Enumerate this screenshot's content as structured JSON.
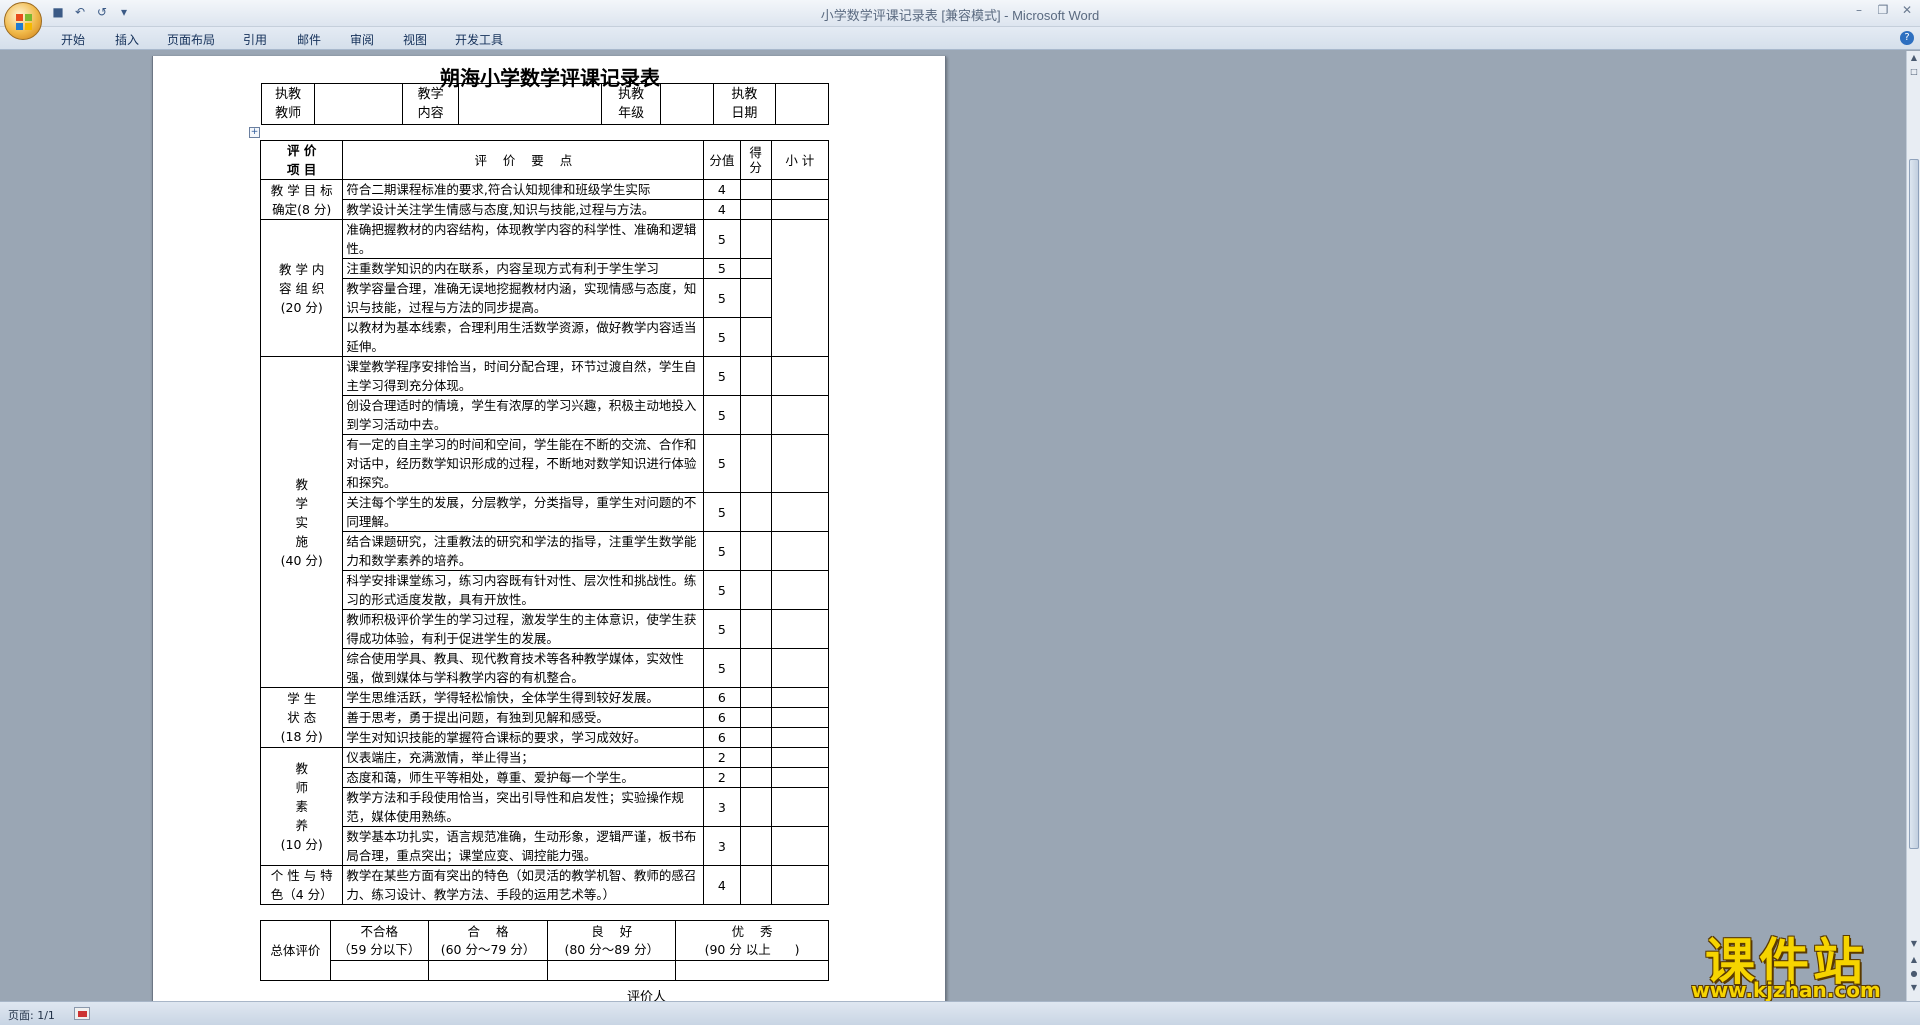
{
  "window": {
    "title": "小学数学评课记录表 [兼容模式] - Microsoft Word"
  },
  "qat": [
    "save-icon",
    "undo-icon",
    "redo-icon",
    "customize-icon"
  ],
  "tabs": [
    "开始",
    "插入",
    "页面布局",
    "引用",
    "邮件",
    "审阅",
    "视图",
    "开发工具"
  ],
  "document": {
    "title": "朔海小学数学评课记录表",
    "info": {
      "teacher_label": "执教\n教师",
      "content_label": "教学\n内容",
      "grade_label": "执教\n年级",
      "date_label": "执教\n日期"
    },
    "headers": {
      "item": "评 价\n项 目",
      "points": "评    价    要    点",
      "score": "分值",
      "got": "得\n分",
      "subtotal": "小 计"
    },
    "sections": [
      {
        "name": "教 学 目 标\n确定(8 分)",
        "rows": [
          {
            "text": "符合二期课程标准的要求,符合认知规律和班级学生实际",
            "score": "4"
          },
          {
            "text": "教学设计关注学生情感与态度,知识与技能,过程与方法。",
            "score": "4"
          }
        ]
      },
      {
        "name": "教 学 内\n容 组 织\n(20 分)",
        "rows": [
          {
            "text": "准确把握教材的内容结构，体现教学内容的科学性、准确和逻辑性。",
            "score": "5"
          },
          {
            "text": "注重数学知识的内在联系，内容呈现方式有利于学生学习",
            "score": "5"
          },
          {
            "text": "教学容量合理，准确无误地挖掘教材内涵，实现情感与态度，知识与技能，过程与方法的同步提高。",
            "score": "5"
          },
          {
            "text": "以教材为基本线索，合理利用生活数学资源，做好教学内容适当延伸。",
            "score": "5"
          }
        ]
      },
      {
        "name": "教\n学\n实\n施\n(40 分)",
        "rows": [
          {
            "text": "课堂教学程序安排恰当，时间分配合理，环节过渡自然，学生自主学习得到充分体现。",
            "score": "5"
          },
          {
            "text": "创设合理适时的情境，学生有浓厚的学习兴趣，积极主动地投入到学习活动中去。",
            "score": "5"
          },
          {
            "text": "有一定的自主学习的时间和空间，学生能在不断的交流、合作和对话中，经历数学知识形成的过程，不断地对数学知识进行体验和探究。",
            "score": "5"
          },
          {
            "text": "关注每个学生的发展，分层教学，分类指导，重学生对问题的不同理解。",
            "score": "5"
          },
          {
            "text": "结合课题研究，注重教法的研究和学法的指导，注重学生数学能力和数学素养的培养。",
            "score": "5"
          },
          {
            "text": "科学安排课堂练习，练习内容既有针对性、层次性和挑战性。练习的形式适度发散，具有开放性。",
            "score": "5"
          },
          {
            "text": "教师积极评价学生的学习过程，激发学生的主体意识，使学生获得成功体验，有利于促进学生的发展。",
            "score": "5"
          },
          {
            "text": "综合使用学具、教具、现代教育技术等各种教学媒体，实效性强，做到媒体与学科教学内容的有机整合。",
            "score": "5"
          }
        ]
      },
      {
        "name": "学 生\n状 态\n(18 分)",
        "rows": [
          {
            "text": "学生思维活跃，学得轻松愉快，全体学生得到较好发展。",
            "score": "6"
          },
          {
            "text": "善于思考，勇于提出问题，有独到见解和感受。",
            "score": "6"
          },
          {
            "text": "学生对知识技能的掌握符合课标的要求，学习成效好。",
            "score": "6"
          }
        ]
      },
      {
        "name": "教\n师\n素\n养\n(10 分)",
        "rows": [
          {
            "text": "仪表端庄，充满激情，举止得当；",
            "score": "2"
          },
          {
            "text": "态度和蔼，师生平等相处，尊重、爱护每一个学生。",
            "score": "2"
          },
          {
            "text": "教学方法和手段使用恰当，突出引导性和启发性；实验操作规范，媒体使用熟练。",
            "score": "3"
          },
          {
            "text": "数学基本功扎实，语言规范准确，生动形象，逻辑严谨，板书布局合理，重点突出；课堂应变、调控能力强。",
            "score": "3"
          }
        ]
      },
      {
        "name": "个 性 与 特\n色（4 分）",
        "rows": [
          {
            "text": "教学在某些方面有突出的特色（如灵活的教学机智、教师的感召力、练习设计、教学方法、手段的运用艺术等。）",
            "score": "4"
          }
        ]
      }
    ],
    "overall": {
      "label": "总体评价",
      "levels": [
        {
          "name": "不合格",
          "range": "（59 分以下）"
        },
        {
          "name": "合    格",
          "range": "(60 分～79 分）"
        },
        {
          "name": "良    好",
          "range": "(80 分～89 分）"
        },
        {
          "name": "优    秀",
          "range": "(90 分 以上      )"
        }
      ]
    },
    "signer": "评价人"
  },
  "status": {
    "page": "页面: 1/1"
  },
  "watermark": {
    "text": "课件站",
    "url": "www.kjzhan.com"
  }
}
